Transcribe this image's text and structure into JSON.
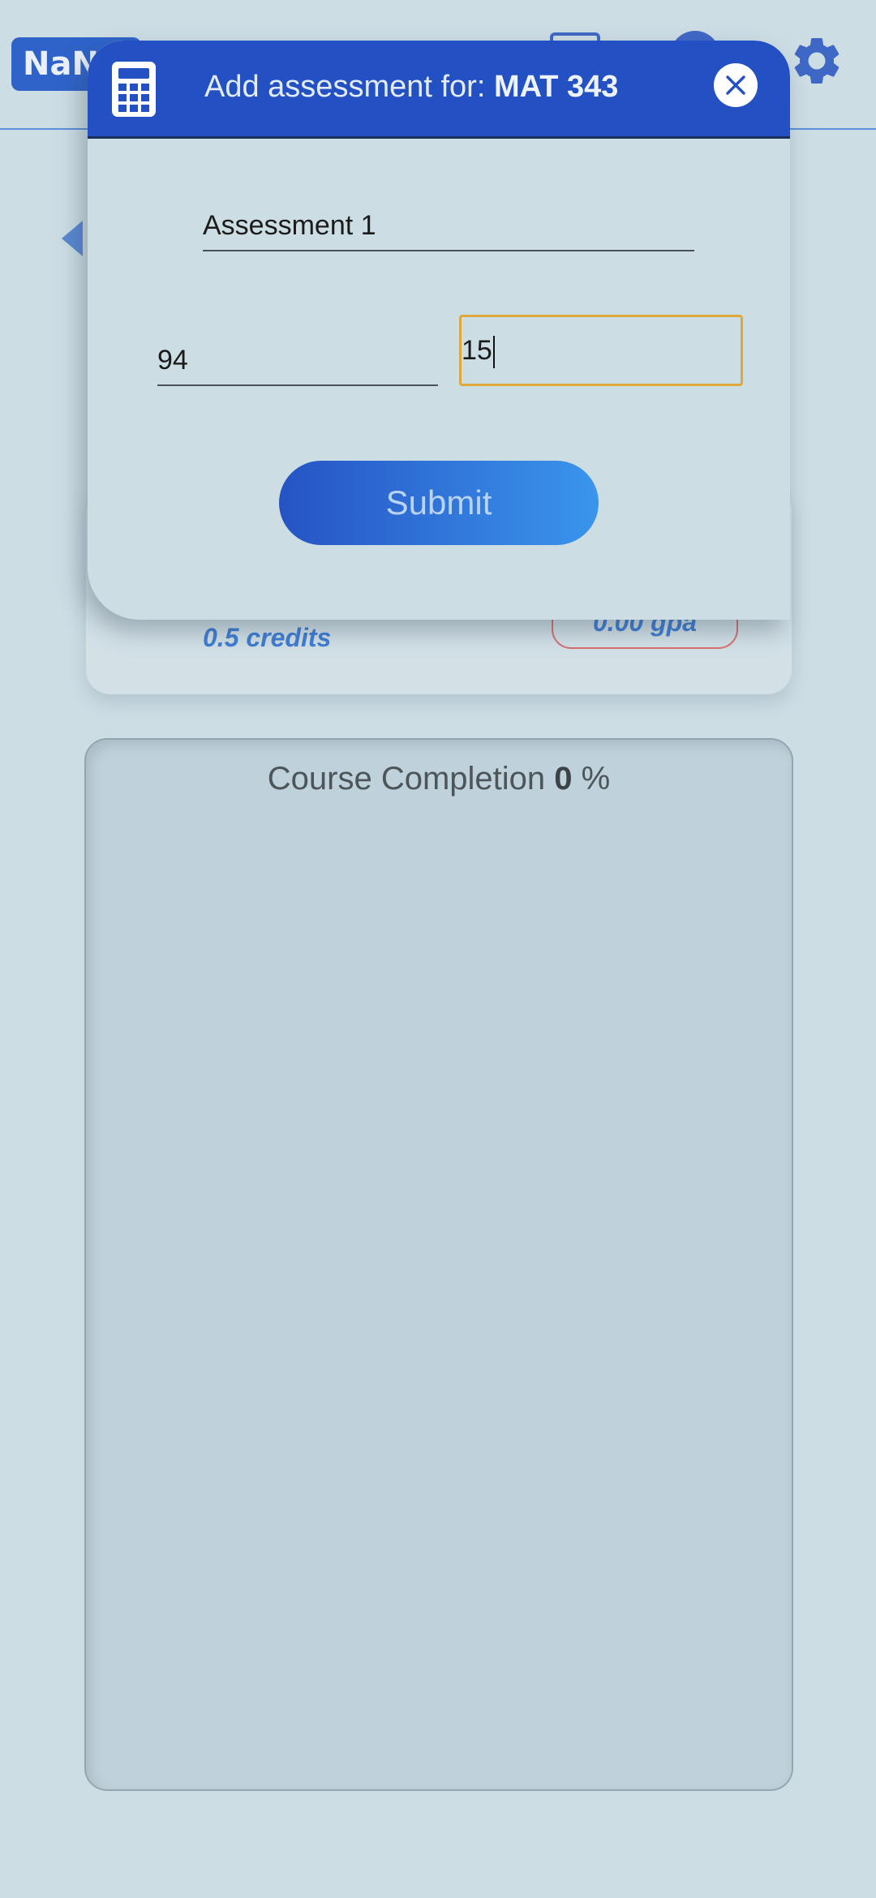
{
  "header": {
    "logo_text": "NaN"
  },
  "course": {
    "credits": "0.5 credits",
    "gpa": "0.00 gpa"
  },
  "completion": {
    "label": "Course Completion",
    "value": "0",
    "unit": "%"
  },
  "modal": {
    "title_prefix": "Add assessment for:",
    "course_code": "MAT 343",
    "name_value": "Assessment 1",
    "grade_value": "94",
    "weight_value": "15",
    "submit_label": "Submit"
  },
  "icons": {
    "settings": "gear-icon",
    "back": "chevron-left-icon",
    "modal_icon": "calculator-icon",
    "close": "close-icon"
  },
  "colors": {
    "accent": "#2350c2",
    "focus": "#e0a73b",
    "background": "#cddde4"
  }
}
